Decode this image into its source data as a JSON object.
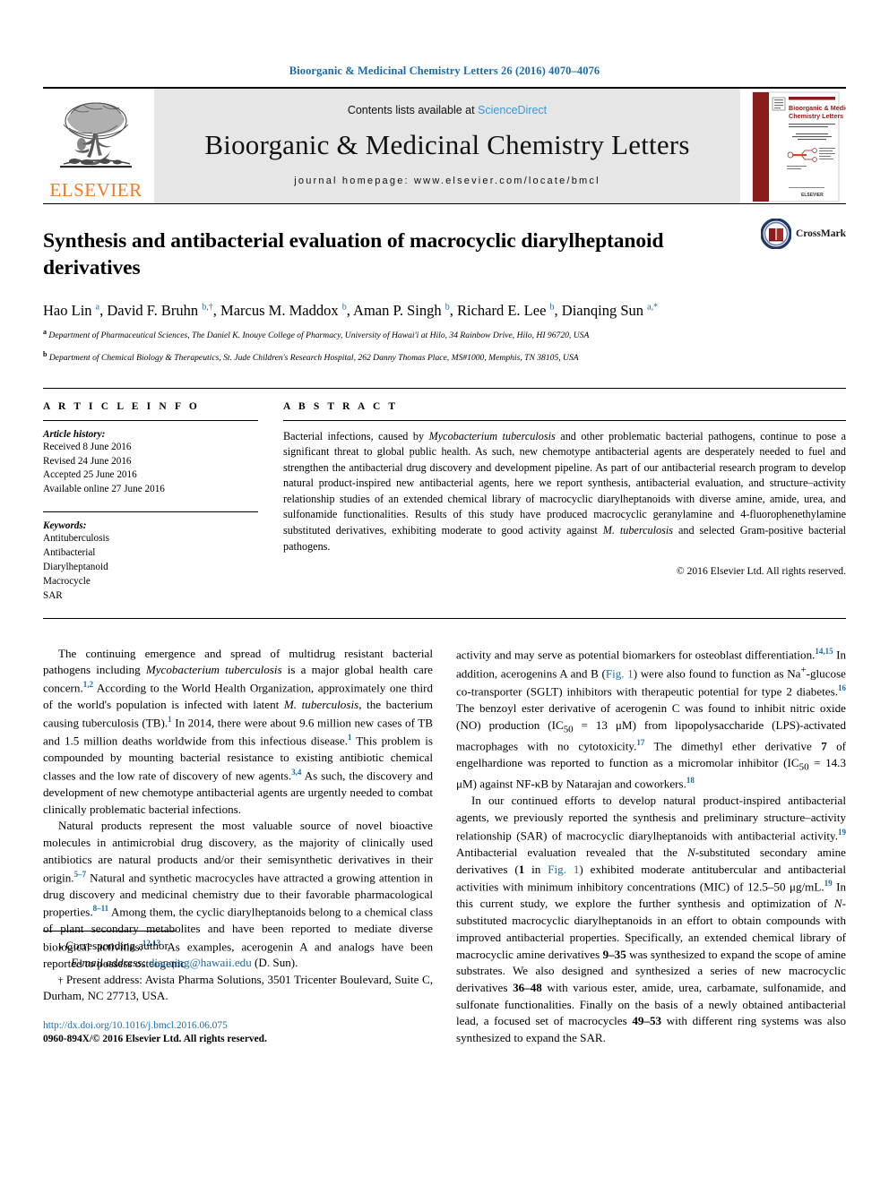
{
  "running_head": "Bioorganic & Medicinal Chemistry Letters 26 (2016) 4070–4076",
  "masthead": {
    "publisher_name": "ELSEVIER",
    "contents_prefix": "Contents lists available at ",
    "sciencedirect": "ScienceDirect",
    "journal_title": "Bioorganic & Medicinal Chemistry Letters",
    "homepage": "journal homepage: www.elsevier.com/locate/bmcl",
    "cover_title": "Bioorganic & Medicinal Chemistry Letters"
  },
  "article": {
    "title": "Synthesis and antibacterial evaluation of macrocyclic diarylheptanoid derivatives",
    "crossmark_label": "CrossMark",
    "authors_html": "Hao Lin <sup>a</sup>, David F. Bruhn <sup>b,†</sup>, Marcus M. Maddox <sup>b</sup>, Aman P. Singh <sup>b</sup>, Richard E. Lee <sup>b</sup>, Dianqing Sun <sup>a,</sup><sup>*</sup>",
    "affiliation_a": "Department of Pharmaceutical Sciences, The Daniel K. Inouye College of Pharmacy, University of Hawai'i at Hilo, 34 Rainbow Drive, Hilo, HI 96720, USA",
    "affiliation_b": "Department of Chemical Biology & Therapeutics, St. Jude Children's Research Hospital, 262 Danny Thomas Place, MS#1000, Memphis, TN 38105, USA"
  },
  "article_info": {
    "heading": "A R T I C L E   I N F O",
    "history_label": "Article history:",
    "history": [
      "Received 8 June 2016",
      "Revised 24 June 2016",
      "Accepted 25 June 2016",
      "Available online 27 June 2016"
    ],
    "keywords_label": "Keywords:",
    "keywords": [
      "Antituberculosis",
      "Antibacterial",
      "Diarylheptanoid",
      "Macrocycle",
      "SAR"
    ]
  },
  "abstract": {
    "heading": "A B S T R A C T",
    "body_html": "Bacterial infections, caused by <i>Mycobacterium tuberculosis</i> and other problematic bacterial pathogens, continue to pose a significant threat to global public health. As such, new chemotype antibacterial agents are desperately needed to fuel and strengthen the antibacterial drug discovery and development pipeline. As part of our antibacterial research program to develop natural product-inspired new antibacterial agents, here we report synthesis, antibacterial evaluation, and structure–activity relationship studies of an extended chemical library of macrocyclic diarylheptanoids with diverse amine, amide, urea, and sulfonamide functionalities. Results of this study have produced macrocyclic geranylamine and 4-fluorophenethylamine substituted derivatives, exhibiting moderate to good activity against <i>M. tuberculosis</i> and selected Gram-positive bacterial pathogens.",
    "copyright": "© 2016 Elsevier Ltd. All rights reserved."
  },
  "body": {
    "left_paragraphs_html": [
      "The continuing emergence and spread of multidrug resistant bacterial pathogens including <i>Mycobacterium tuberculosis</i> is a major global health care concern.<sup class=\"ref\">1,2</sup> According to the World Health Organization, approximately one third of the world's population is infected with latent <i>M. tuberculosis</i>, the bacterium causing tuberculosis (TB).<sup class=\"ref\">1</sup> In 2014, there were about 9.6 million new cases of TB and 1.5 million deaths worldwide from this infectious disease.<sup class=\"ref\">1</sup> This problem is compounded by mounting bacterial resistance to existing antibiotic chemical classes and the low rate of discovery of new agents.<sup class=\"ref\">3,4</sup> As such, the discovery and development of new chemotype antibacterial agents are urgently needed to combat clinically problematic bacterial infections.",
      "Natural products represent the most valuable source of novel bioactive molecules in antimicrobial drug discovery, as the majority of clinically used antibiotics are natural products and/or their semisynthetic derivatives in their origin.<sup class=\"ref\">5–7</sup> Natural and synthetic macrocycles have attracted a growing attention in drug discovery and medicinal chemistry due to their favorable pharmacological properties.<sup class=\"ref\">8–11</sup> Among them, the cyclic diarylheptanoids belong to a chemical class of plant secondary metabolites and have been reported to mediate diverse biological activities.<sup class=\"ref\">12,13</sup> As examples, acerogenin A and analogs have been reported to possess osteogenic"
    ],
    "right_paragraphs_html": [
      "activity and may serve as potential biomarkers for osteoblast differentiation.<sup class=\"ref\">14,15</sup> In addition, acerogenins A and B (<span class=\"bl\">Fig. 1</span>) were also found to function as Na<sup>+</sup>-glucose co-transporter (SGLT) inhibitors with therapeutic potential for type 2 diabetes.<sup class=\"ref\">16</sup> The benzoyl ester derivative of acerogenin C was found to inhibit nitric oxide (NO) production (IC<sub>50</sub> = 13 μM) from lipopolysaccharide (LPS)-activated macrophages with no cytotoxicity.<sup class=\"ref\">17</sup> The dimethyl ether derivative <b>7</b> of engelhardione was reported to function as a micromolar inhibitor (IC<sub>50</sub> = 14.3 μM) against NF-κB by Natarajan and coworkers.<sup class=\"ref\">18</sup>",
      "In our continued efforts to develop natural product-inspired antibacterial agents, we previously reported the synthesis and preliminary structure–activity relationship (SAR) of macrocyclic diarylheptanoids with antibacterial activity.<sup class=\"ref\">19</sup> Antibacterial evaluation revealed that the <i>N</i>-substituted secondary amine derivatives (<b>1</b> in <span class=\"bl\">Fig. 1</span>) exhibited moderate antitubercular and antibacterial activities with minimum inhibitory concentrations (MIC) of 12.5–50 μg/mL.<sup class=\"ref\">19</sup> In this current study, we explore the further synthesis and optimization of <i>N</i>-substituted macrocyclic diarylheptanoids in an effort to obtain compounds with improved antibacterial properties. Specifically, an extended chemical library of macrocyclic amine derivatives <b>9–35</b> was synthesized to expand the scope of amine substrates. We also designed and synthesized a series of new macrocyclic derivatives <b>36–48</b> with various ester, amide, urea, carbamate, sulfonamide, and sulfonate functionalities. Finally on the basis of a newly obtained antibacterial lead, a focused set of macrocycles <b>49–53</b> with different ring systems was also synthesized to expand the SAR."
    ]
  },
  "footnotes": {
    "corresponding_html": "<span class=\"mark\">⁎</span> Corresponding author.",
    "email_html": "<i>E-mail address:</i> <span class=\"link\">dianqing@hawaii.edu</span> (D. Sun).",
    "present_address_html": "<span class=\"mark\">†</span> Present address: Avista Pharma Solutions, 3501 Tricenter Boulevard, Suite C, Durham, NC 27713, USA.",
    "doi": "http://dx.doi.org/10.1016/j.bmcl.2016.06.075",
    "issn": "0960-894X/© 2016 Elsevier Ltd. All rights reserved."
  },
  "colors": {
    "link_blue": "#1b6ca8",
    "sciencedirect_blue": "#3a9ad9",
    "elsevier_orange": "#f47920",
    "cover_red": "#8b1a1a"
  }
}
